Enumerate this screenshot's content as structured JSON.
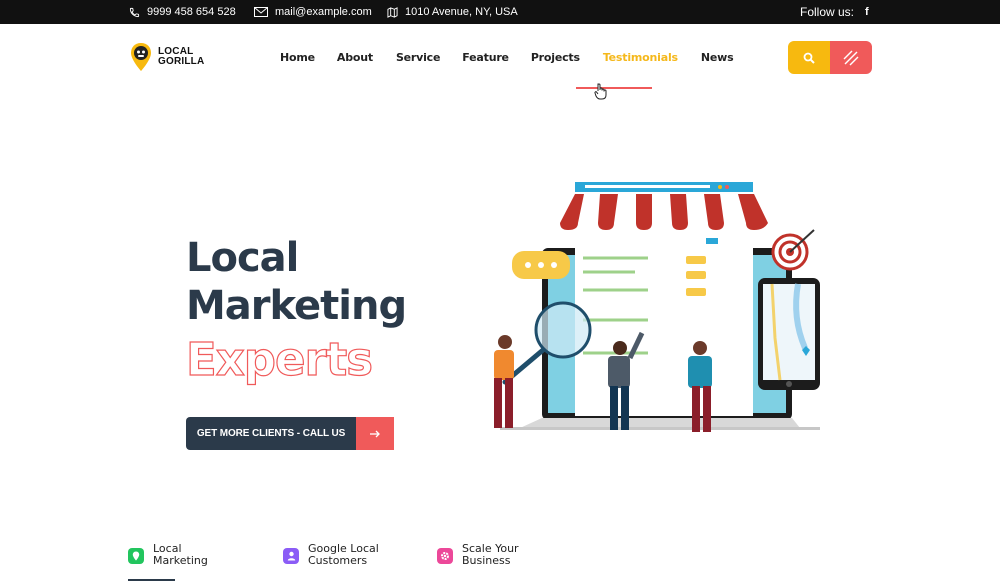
{
  "topbar": {
    "phone": "9999 458 654 528",
    "email": "mail@example.com",
    "address": "1010 Avenue, NY, USA",
    "follow_label": "Follow us:",
    "social_icon": "facebook-icon"
  },
  "logo": {
    "line1": "LOCAL",
    "line2": "GORILLA"
  },
  "nav": {
    "items": [
      "Home",
      "About",
      "Service",
      "Feature",
      "Projects",
      "Testimonials",
      "News"
    ],
    "active": "Testimonials"
  },
  "header_buttons": {
    "search_icon": "search-icon",
    "menu_icon": "menu-lines-icon"
  },
  "hero": {
    "line1": "Local",
    "line2": "Marketing",
    "line3": "Experts",
    "cta_label": "GET MORE CLIENTS - CALL US",
    "cta_icon": "arrow-right-icon"
  },
  "features": [
    {
      "line1": "Local",
      "line2": "Marketing",
      "color": "#22c55e"
    },
    {
      "line1": "Google Local",
      "line2": "Customers",
      "color": "#8b5cf6"
    },
    {
      "line1": "Scale Your",
      "line2": "Business",
      "color": "#ec4899"
    }
  ],
  "colors": {
    "accent_yellow": "#f7b90f",
    "accent_red": "#f05a5a",
    "dark": "#2b3a4a"
  }
}
